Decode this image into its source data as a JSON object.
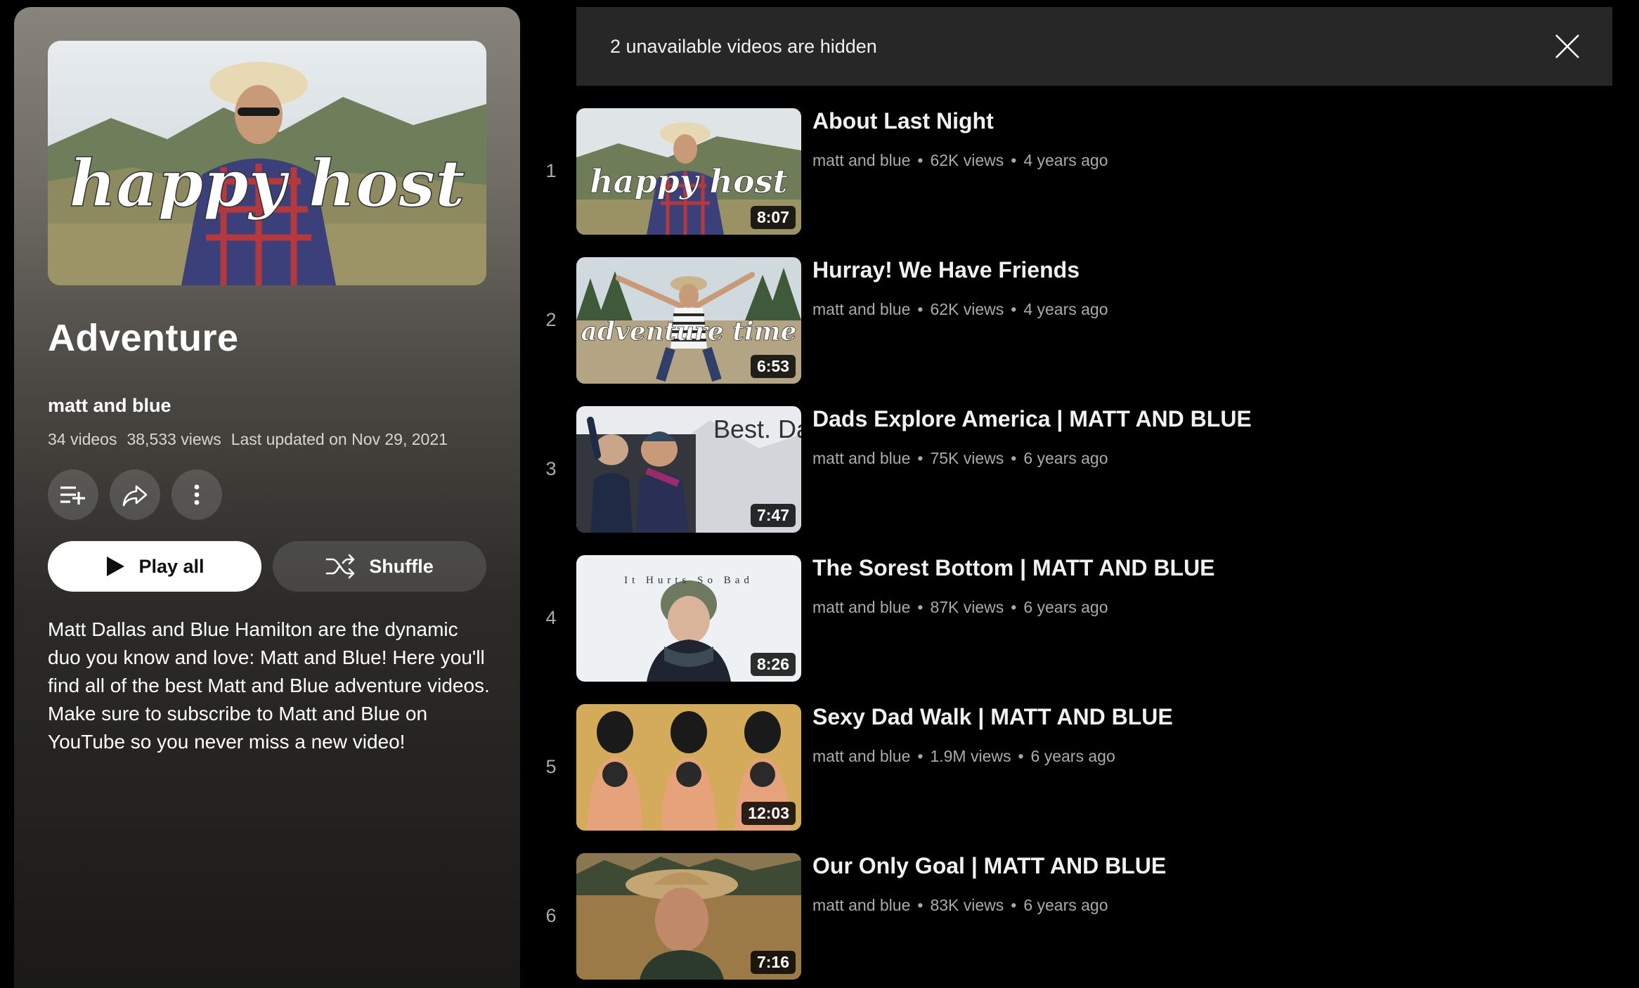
{
  "banner": {
    "text": "2 unavailable videos are hidden"
  },
  "playlist": {
    "hero_text": "happy host",
    "title": "Adventure",
    "owner": "matt and blue",
    "video_count": "34 videos",
    "view_count": "38,533 views",
    "last_updated": "Last updated on Nov 29, 2021",
    "play_all_label": "Play all",
    "shuffle_label": "Shuffle",
    "description": "Matt Dallas and Blue Hamilton are the dynamic duo you know and love: Matt and Blue! Here you'll find all of the best Matt and Blue adventure videos. Make sure to subscribe to Matt and Blue on YouTube so you never miss a new video!"
  },
  "icons": {
    "save": "playlist-add-icon",
    "share": "share-icon",
    "more": "more-vertical-icon",
    "play": "play-icon",
    "shuffle": "shuffle-icon",
    "close": "close-icon"
  },
  "videos": [
    {
      "index": "1",
      "title": "About Last Night",
      "channel": "matt and blue",
      "views": "62K views",
      "age": "4 years ago",
      "duration": "8:07",
      "thumb_text": "happy host"
    },
    {
      "index": "2",
      "title": "Hurray! We Have Friends",
      "channel": "matt and blue",
      "views": "62K views",
      "age": "4 years ago",
      "duration": "6:53",
      "thumb_text": "adventure time"
    },
    {
      "index": "3",
      "title": "Dads Explore America | MATT AND BLUE",
      "channel": "matt and blue",
      "views": "75K views",
      "age": "6 years ago",
      "duration": "7:47",
      "thumb_text": "Best. Day. Ever."
    },
    {
      "index": "4",
      "title": "The Sorest Bottom | MATT AND BLUE",
      "channel": "matt and blue",
      "views": "87K views",
      "age": "6 years ago",
      "duration": "8:26",
      "thumb_text": "It Hurts So Bad"
    },
    {
      "index": "5",
      "title": "Sexy Dad Walk | MATT AND BLUE",
      "channel": "matt and blue",
      "views": "1.9M views",
      "age": "6 years ago",
      "duration": "12:03",
      "thumb_text": ""
    },
    {
      "index": "6",
      "title": "Our Only Goal | MATT AND BLUE",
      "channel": "matt and blue",
      "views": "83K views",
      "age": "6 years ago",
      "duration": "7:16",
      "thumb_text": ""
    }
  ]
}
